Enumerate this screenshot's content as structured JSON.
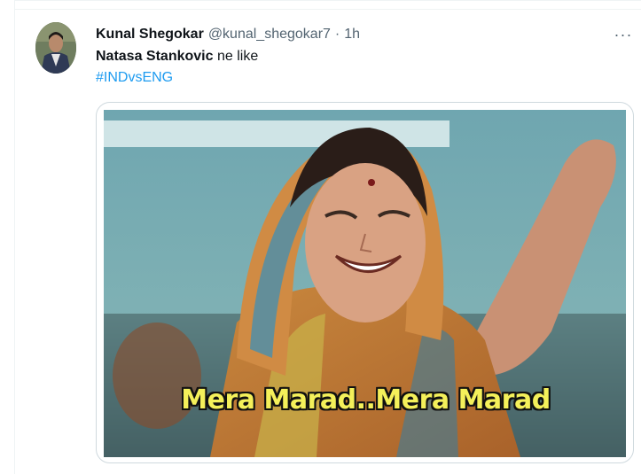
{
  "tweet": {
    "author_name": "Kunal Shegokar",
    "author_handle": "@kunal_shegokar7",
    "separator": "·",
    "timestamp": "1h",
    "more_icon": "ellipsis-icon",
    "text_bold": "Natasa Stankovic",
    "text_rest": " ne like",
    "hashtag": "#INDvsENG",
    "media": {
      "caption": "Mera Marad..Mera Marad"
    }
  },
  "colors": {
    "link": "#1d9bf0",
    "secondary_text": "#536471",
    "border": "#cfd9de",
    "caption_text": "#f4f05a"
  }
}
